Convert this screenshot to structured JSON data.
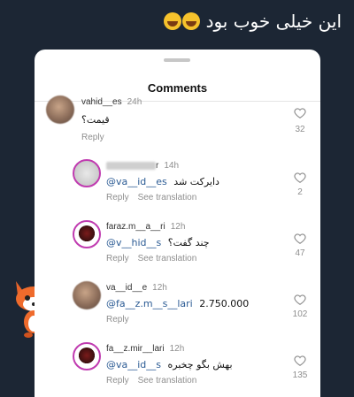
{
  "caption": "این خیلی خوب بود",
  "sheet": {
    "title": "Comments"
  },
  "comments": [
    {
      "username": "vahid__es",
      "time": "24h",
      "text": "قیمت؟",
      "reply": "Reply",
      "likes": "32"
    },
    {
      "username": "r",
      "time": "14h",
      "mention": "@va__id__es",
      "text": "دایرکت شد",
      "reply": "Reply",
      "translate": "See translation",
      "likes": "2"
    },
    {
      "username": "faraz.m__a__ri",
      "time": "12h",
      "mention": "@v__hid__s",
      "text": "چند گفت؟",
      "reply": "Reply",
      "translate": "See translation",
      "likes": "47"
    },
    {
      "username": "va__id__e",
      "time": "12h",
      "mention": "@fa__z.m__s__lari",
      "text": "2.750.000",
      "reply": "Reply",
      "likes": "102"
    },
    {
      "username": "fa__z.mir__lari",
      "time": "12h",
      "mention": "@va__id__s",
      "text": "بهش بگو چخبره",
      "reply": "Reply",
      "translate": "See translation",
      "likes": "135"
    }
  ],
  "icons": {
    "like": "heart-outline-icon",
    "sticker": "fox-sticker"
  },
  "colors": {
    "background": "#1c2634",
    "sheet": "#ffffff",
    "mention": "#2b5b94",
    "avatar_ring": "#c03bb0"
  }
}
